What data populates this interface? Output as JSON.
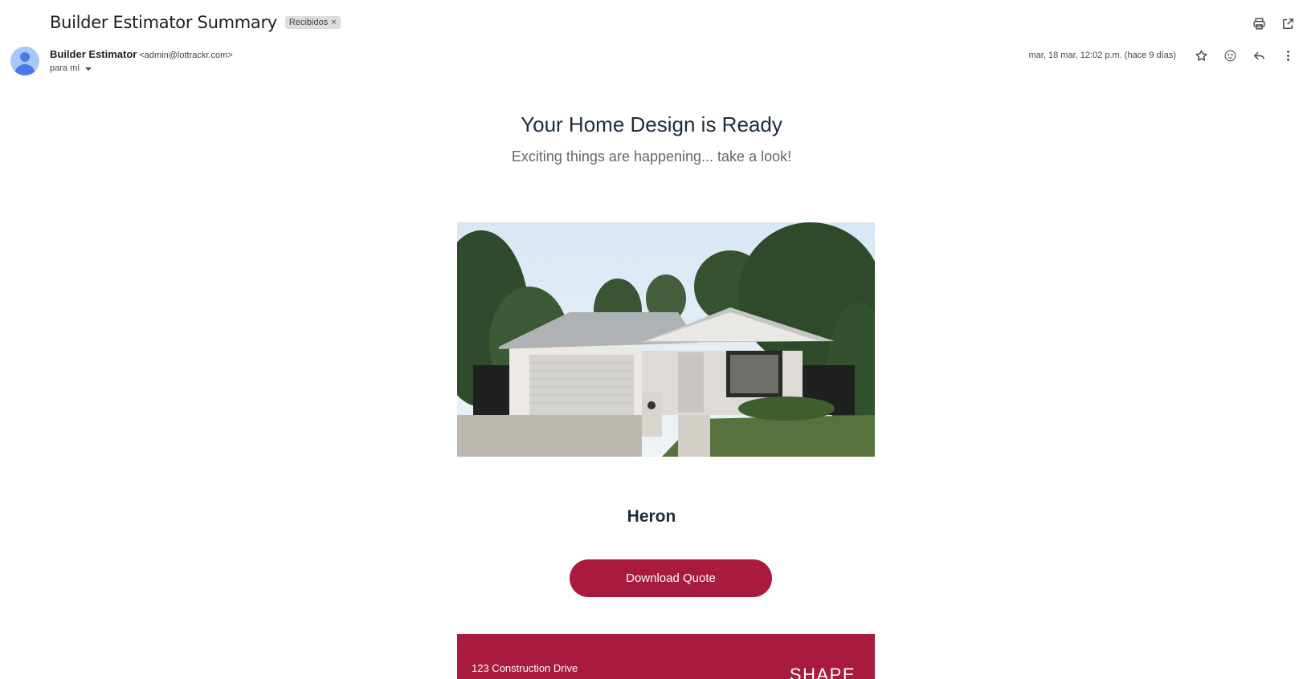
{
  "email": {
    "subject": "Builder Estimator Summary",
    "label": "Recibidos",
    "label_remove": "×",
    "sender_name": "Builder Estimator",
    "sender_email": "<admin@lottrackr.com>",
    "to_line": "para mí",
    "date": "mar, 18 mar, 12:02 p.m. (hace 9 días)"
  },
  "content": {
    "headline": "Your Home Design is Ready",
    "subheadline": "Exciting things are happening... take a look!",
    "design_name": "Heron",
    "button_label": "Download Quote",
    "footer_address": "123 Construction Drive",
    "footer_logo": "SHAPE"
  },
  "icons": {
    "print": "print-icon",
    "open_new": "open-in-new-window-icon",
    "star": "star-icon",
    "emoji": "emoji-reaction-icon",
    "reply": "reply-icon",
    "more": "more-vertical-icon"
  },
  "colors": {
    "brand": "#a81a3e",
    "headline": "#1c2b3a"
  }
}
